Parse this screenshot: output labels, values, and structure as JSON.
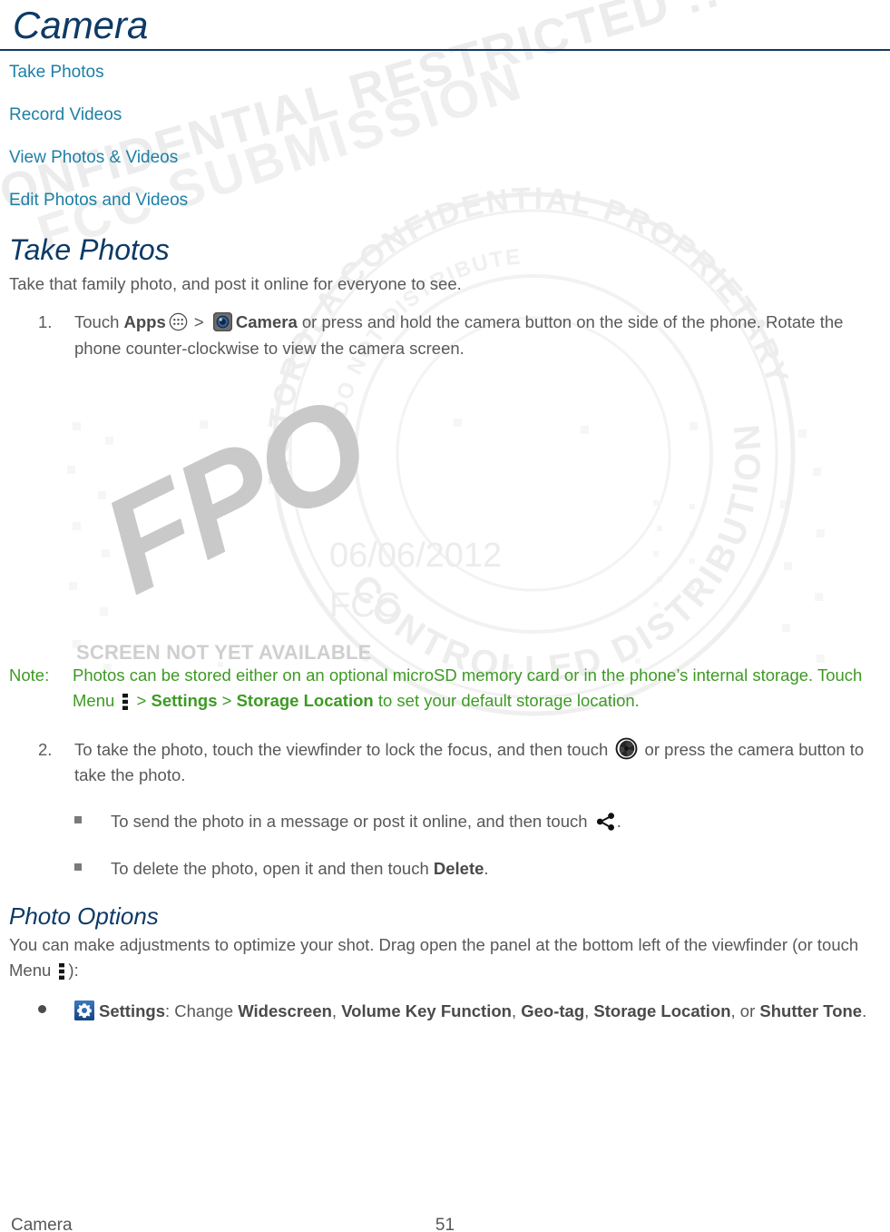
{
  "document": {
    "title": "Camera",
    "footer": {
      "left": "Camera",
      "page_number": "51"
    }
  },
  "colors": {
    "heading_navy": "#0d3a66",
    "link_teal": "#1d7fa6",
    "note_green": "#3d9a23",
    "body_gray": "#585858",
    "settings_icon_blue": "#1f62ab"
  },
  "toc": {
    "items": [
      {
        "label": "Take Photos"
      },
      {
        "label": "Record Videos"
      },
      {
        "label": "View Photos & Videos"
      },
      {
        "label": "Edit Photos and Videos"
      }
    ]
  },
  "take_photos": {
    "heading": "Take Photos",
    "intro": "Take that family photo, and post it online for everyone to see.",
    "steps": [
      {
        "number": "1.",
        "part1": "Touch ",
        "bold1": "Apps",
        "icon1": "apps-grid-icon",
        "sep1": " > ",
        "icon2": "camera-app-icon",
        "bold2": "Camera",
        "part2": " or press and hold the camera button on the side of the phone. Rotate the phone counter-clockwise to view the camera screen."
      },
      {
        "number": "2.",
        "part1": "To take the photo, touch the viewfinder to lock the focus, and then touch ",
        "icon1": "shutter-icon",
        "part2": " or press the camera button to take the photo."
      }
    ],
    "sub_bullets": [
      {
        "text_before": "To send the photo in a message or post it online, and then touch ",
        "icon": "share-icon",
        "text_after": "."
      },
      {
        "text_before": "To delete the photo, open it and then touch ",
        "bold": "Delete",
        "text_after": "."
      }
    ]
  },
  "note": {
    "label": "Note:",
    "part1": "Photos can be stored either on an optional microSD memory card or in the phone’s internal storage. Touch Menu ",
    "icon": "overflow-menu-icon",
    "sep1": " > ",
    "bold1": "Settings",
    "sep2": " > ",
    "bold2": "Storage Location",
    "part2": " to set your default storage location."
  },
  "photo_options": {
    "heading": "Photo Options",
    "intro_part1": "You can make adjustments to optimize your shot. Drag open the panel at the bottom left of the viewfinder (or touch Menu ",
    "intro_icon": "overflow-menu-icon",
    "intro_part2": "):",
    "bullets": [
      {
        "icon": "settings-gear-icon",
        "bold_label": "Settings",
        "text1": ": Change ",
        "opt1": "Widescreen",
        "sep1": ", ",
        "opt2": "Volume Key Function",
        "sep2": ", ",
        "opt3": "Geo-tag",
        "sep3": ", ",
        "opt4": "Storage Location",
        "sep4": ", or ",
        "opt5": "Shutter Tone",
        "text2": "."
      }
    ]
  },
  "placeholder_image": {
    "fpo_text": "FPO",
    "date": "06/06/2012",
    "agency": "FCC",
    "caption": "SCREEN NOT YET AVAILABLE"
  },
  "watermark": {
    "band_text": "CONFIDENTIAL RESTRICTED :: MOTOROLA CONFIDENTIAL",
    "band_text2": "FCC SUBMISSION",
    "stamp_top_text": "MOTOROLA CONFIDENTIAL PROPRIETARY",
    "stamp_bottom_text": "CONTROLLED DISTRIBUTION",
    "stamp_inner_text": "DO NOT DISTRIBUTE"
  }
}
